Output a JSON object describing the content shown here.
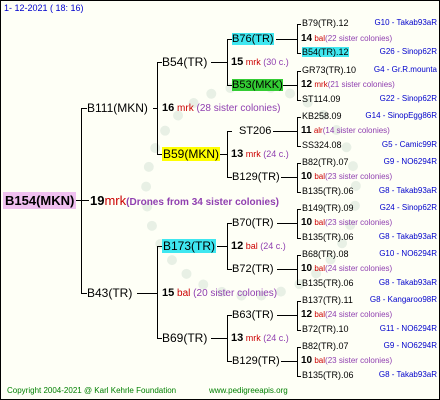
{
  "header": {
    "date": "1-  12-2021  ( 18:  16)"
  },
  "footer": {
    "copyright": "Copyright 2004-2021 @ Karl Kehrle Foundation",
    "site": "www.pedigreeapis.org"
  },
  "colors": {
    "magenta_box": "#f0c0f0",
    "cyan_box": "#3fe7f0",
    "yellow_box": "#ffff00",
    "green_box": "#33cc33"
  },
  "root": {
    "name": "B154(MKN)",
    "num": "19",
    "code": "mrk",
    "note": "(Drones from 34 sister colonies)"
  },
  "gen1": [
    {
      "name": "B111(MKN)",
      "num": "16",
      "code": "mrk",
      "note": "(28 sister colonies)"
    },
    {
      "name": "B43(TR)",
      "num": "15",
      "code": "bal",
      "note": "(20 sister colonies)"
    }
  ],
  "gen2": [
    {
      "name": "B54(TR)",
      "num": "15",
      "code": "mrk",
      "note": "(30 c.)"
    },
    {
      "name": "B59(MKN)",
      "num": "13",
      "code": "mrk",
      "note": "(24 c.)"
    },
    {
      "name": "B173(TR)",
      "num": "12",
      "code": "bal",
      "note": "(24 c.)"
    },
    {
      "name": "B69(TR)",
      "num": "13",
      "code": "mrk",
      "note": "(24 c.)"
    }
  ],
  "gen3": [
    {
      "name": "B76(TR)",
      "num": "14",
      "code": "bal",
      "note": "(22 sister colonies)"
    },
    {
      "name": "B53(MKK)",
      "num": "12",
      "code": "mrk",
      "note": "(21 sister colonies)"
    },
    {
      "name": "ST206",
      "num": "11",
      "code": "alr",
      "note": "(14 sister colonies)"
    },
    {
      "name": "B129(TR)",
      "num": "10",
      "code": "bal",
      "note": "(23 sister colonies)"
    },
    {
      "name": "B70(TR)",
      "num": "10",
      "code": "bal",
      "note": "(23 sister colonies)"
    },
    {
      "name": "B72(TR)",
      "num": "10",
      "code": "bal",
      "note": "(24 sister colonies)"
    },
    {
      "name": "B63(TR)",
      "num": "12",
      "code": "bal",
      "note": "(24 sister colonies)"
    },
    {
      "name": "B129(TR)",
      "num": "10",
      "code": "bal",
      "note": "(23 sister colonies)"
    }
  ],
  "gen4": [
    {
      "name": "B79(TR).12",
      "code": "G10 - Takab93aR"
    },
    {
      "name": "B54(TR).12",
      "code": "G26 - Sinop62R"
    },
    {
      "name": "GR73(TR).10",
      "code": "G4 - Gr.R.mounta"
    },
    {
      "name": "ST114.09",
      "code": "G22 - Sinop62R"
    },
    {
      "name": "KB258.09",
      "code": "G14 - SinopEgg86R"
    },
    {
      "name": "SS324.08",
      "code": "G5 - Camic99R"
    },
    {
      "name": "B82(TR).07",
      "code": "G9 - NO6294R"
    },
    {
      "name": "B135(TR).06",
      "code": "G8 - Takab93aR"
    },
    {
      "name": "B149(TR).09",
      "code": "G24 - Sinop62R"
    },
    {
      "name": "B135(TR).06",
      "code": "G8 - Takab93aR"
    },
    {
      "name": "B68(TR).08",
      "code": "G10 - NO6294R"
    },
    {
      "name": "B135(TR).06",
      "code": "G8 - Takab93aR"
    },
    {
      "name": "B137(TR).11",
      "code": "G8 - Kangaroo98R"
    },
    {
      "name": "B72(TR).10",
      "code": "G11 - NO6294R"
    },
    {
      "name": "B82(TR).07",
      "code": "G9 - NO6294R"
    },
    {
      "name": "B135(TR).06",
      "code": "G8 - Takab93aR"
    }
  ]
}
